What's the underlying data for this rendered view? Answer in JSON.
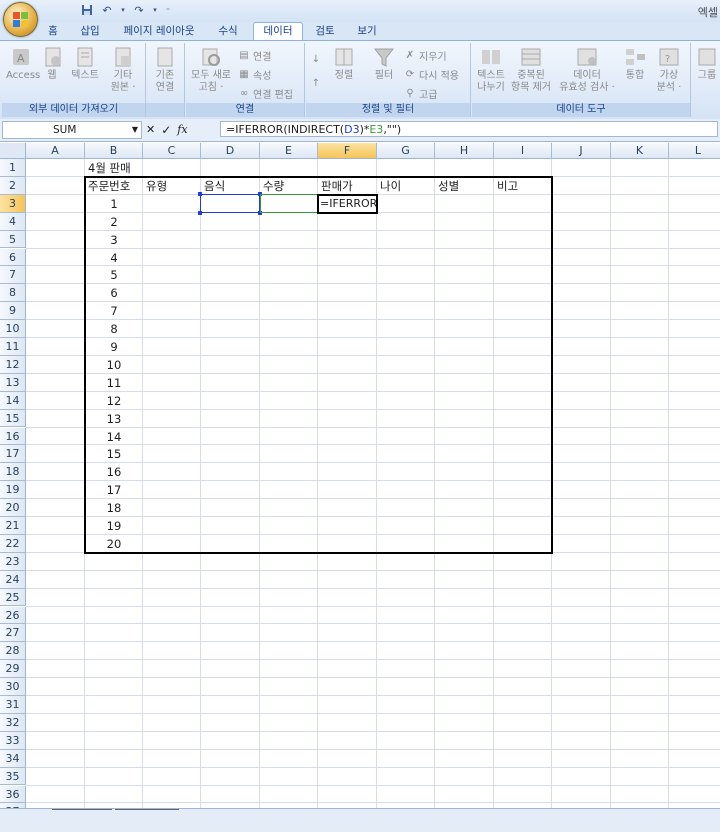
{
  "app": {
    "title": "엑셀"
  },
  "tabs": [
    {
      "label": "홈",
      "active": false
    },
    {
      "label": "삽입",
      "active": false
    },
    {
      "label": "페이지 레이아웃",
      "active": false
    },
    {
      "label": "수식",
      "active": false
    },
    {
      "label": "데이터",
      "active": true
    },
    {
      "label": "검토",
      "active": false
    },
    {
      "label": "보기",
      "active": false
    }
  ],
  "ribbon": {
    "groups": {
      "external": "외부 데이터 가져오기",
      "connections": "연결",
      "sort_filter": "정렬 및 필터",
      "data_tools": "데이터 도구"
    },
    "buttons": {
      "access": "Access",
      "web": "웹",
      "text": "텍스트",
      "other_l1": "기타",
      "other_l2": "원본 ·",
      "existing_l1": "기존",
      "existing_l2": "연결",
      "refresh_l1": "모두 새로",
      "refresh_l2": "고침 ·",
      "conn": "연결",
      "props": "속성",
      "edit_links": "연결 편집",
      "sort": "정렬",
      "filter": "필터",
      "clear": "지우기",
      "reapply": "다시 적용",
      "advanced": "고급",
      "text_to_cols_l1": "텍스트",
      "text_to_cols_l2": "나누기",
      "remove_dup_l1": "중복된",
      "remove_dup_l2": "항목 제거",
      "validation_l1": "데이터",
      "validation_l2": "유효성 검사 ·",
      "consolidate": "통합",
      "whatif_l1": "가상",
      "whatif_l2": "분석 ·",
      "group_l1": "그룹"
    }
  },
  "formula_bar": {
    "name_box": "SUM",
    "cancel": "✕",
    "enter": "✓",
    "fx": "fx",
    "formula_prefix": "=IFERROR(INDIRECT(",
    "ref_d3": "D3",
    "formula_mid": ")*",
    "ref_e3": "E3",
    "formula_suffix": ",\"\")"
  },
  "grid": {
    "columns": [
      "A",
      "B",
      "C",
      "D",
      "E",
      "F",
      "G",
      "H",
      "I",
      "J",
      "K",
      "L"
    ],
    "selected_column": "F",
    "selected_row": 3,
    "rows_visible": 37,
    "b1": "4월 판매",
    "headers": [
      "주문번호",
      "유형",
      "음식",
      "수량",
      "판매가",
      "나이",
      "성별",
      "비고"
    ],
    "order_numbers": [
      "1",
      "2",
      "3",
      "4",
      "5",
      "6",
      "7",
      "8",
      "9",
      "10",
      "11",
      "12",
      "13",
      "14",
      "15",
      "16",
      "17",
      "18",
      "19",
      "20"
    ],
    "active_cell_text": "=IFERROR"
  },
  "colors": {
    "accent": "#15428b",
    "ref_blue": "#1f3fd1",
    "ref_green": "#3a9a3a",
    "selected_header": "#f6c45a"
  }
}
